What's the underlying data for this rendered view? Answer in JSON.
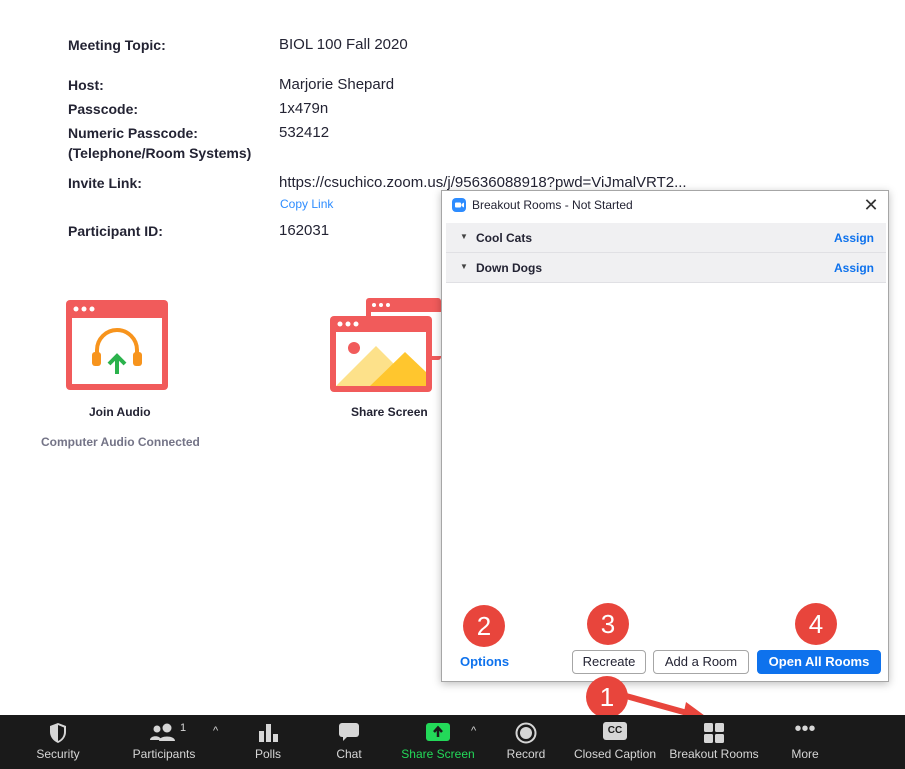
{
  "meeting": {
    "topic_label": "Meeting Topic:",
    "topic_value": "BIOL 100 Fall 2020",
    "host_label": "Host:",
    "host_value": "Marjorie Shepard",
    "passcode_label": "Passcode:",
    "passcode_value": "1x479n",
    "numeric_passcode_label": "Numeric Passcode:",
    "numeric_passcode_sub": "(Telephone/Room Systems)",
    "numeric_passcode_value": "532412",
    "invite_label": "Invite Link:",
    "invite_value": "https://csuchico.zoom.us/j/95636088918?pwd=ViJmalVRT2...",
    "copy_link": "Copy Link",
    "participant_id_label": "Participant ID:",
    "participant_id_value": "162031"
  },
  "tiles": {
    "join_audio": "Join Audio",
    "audio_status": "Computer Audio Connected",
    "share_screen": "Share Screen"
  },
  "dialog": {
    "title": "Breakout Rooms - Not Started",
    "close": "✕",
    "rooms": [
      {
        "name": "Cool Cats",
        "action": "Assign"
      },
      {
        "name": "Down Dogs",
        "action": "Assign"
      }
    ],
    "options": "Options",
    "recreate": "Recreate",
    "add_room": "Add a Room",
    "open_all": "Open All Rooms"
  },
  "callouts": [
    "1",
    "2",
    "3",
    "4"
  ],
  "toolbar": {
    "security": "Security",
    "participants": "Participants",
    "participant_count": "1",
    "polls": "Polls",
    "chat": "Chat",
    "share_screen": "Share Screen",
    "record": "Record",
    "closed_caption": "Closed Caption",
    "cc_icon": "CC",
    "breakout_rooms": "Breakout Rooms",
    "more": "More"
  },
  "colors": {
    "accent": "#0e72ed",
    "callout": "#e8453c",
    "tile": "#f15b5b",
    "toolbar_bg": "#1a1a1a",
    "share_green": "#23d959"
  }
}
